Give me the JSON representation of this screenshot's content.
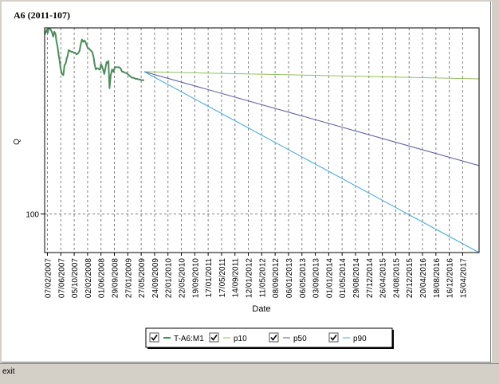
{
  "status_bar": {
    "text": "exit"
  },
  "colors": {
    "panel_bg": "#ffffff",
    "plot_border": "#000000",
    "grid": "#808080",
    "title": "#00008b",
    "history": "#4e8a5c",
    "p10": "#8fbf5f",
    "p50": "#5a5a9c",
    "p90": "#48a8d0"
  },
  "chart_data": {
    "type": "line",
    "title": "A6 (2011-107)",
    "xlabel": "Date",
    "ylabel": "Q",
    "y_scale": "log",
    "ylim": [
      60,
      1180
    ],
    "y_ticks": [
      100
    ],
    "grid": "dashed vertical at each x tick, dashed horizontal at y tick",
    "legend_position": "bottom-center",
    "x_ticks": [
      "07/02/2007",
      "07/06/2007",
      "05/10/2007",
      "02/02/2008",
      "01/06/2008",
      "29/09/2008",
      "27/01/2009",
      "27/05/2009",
      "24/09/2009",
      "22/01/2010",
      "22/05/2010",
      "19/09/2010",
      "17/01/2011",
      "17/05/2011",
      "14/09/2011",
      "12/01/2012",
      "11/05/2012",
      "08/09/2012",
      "06/01/2013",
      "06/05/2013",
      "03/09/2013",
      "01/01/2014",
      "01/05/2014",
      "29/08/2014",
      "27/12/2014",
      "26/04/2015",
      "24/08/2015",
      "22/12/2015",
      "20/04/2016",
      "18/08/2016",
      "16/12/2016",
      "15/04/2017"
    ],
    "x_tick_offsets": [
      12,
      8,
      4,
      0,
      -4,
      -8,
      -12,
      -16,
      -20,
      -24,
      -28,
      -32,
      -36,
      -40,
      -44,
      -48,
      -52,
      -56,
      -60,
      -64,
      -68,
      -72,
      -76,
      -80,
      -84,
      -88,
      -92,
      -96,
      -100,
      -104,
      -108,
      -112
    ],
    "x_domain_days": [
      -12,
      3750
    ],
    "series": [
      {
        "name": "T-A6:M1",
        "checked": true,
        "color_key": "history",
        "x": [
          -12,
          5,
          15,
          22,
          30,
          38,
          50,
          62,
          72,
          82,
          90,
          100,
          110,
          118,
          126,
          138,
          150,
          160,
          170,
          180,
          188,
          196,
          206,
          218,
          228,
          240,
          252,
          264,
          276,
          290,
          302,
          312,
          322,
          332,
          342,
          352,
          362,
          372,
          382,
          392,
          402,
          412,
          422,
          432,
          440,
          450,
          460,
          468,
          476,
          484,
          494,
          504,
          514,
          524,
          532,
          540,
          550,
          560,
          572,
          584,
          596,
          610,
          622,
          634,
          646,
          658,
          670,
          682,
          694,
          706,
          718,
          730,
          742,
          754,
          766,
          778,
          790,
          802,
          814,
          826,
          838,
          850
        ],
        "y": [
          1080,
          1150,
          1100,
          1170,
          1175,
          1160,
          1120,
          1050,
          1120,
          1090,
          990,
          920,
          820,
          760,
          690,
          640,
          630,
          720,
          735,
          790,
          820,
          880,
          870,
          860,
          860,
          850,
          850,
          830,
          840,
          870,
          960,
          1010,
          980,
          1000,
          980,
          940,
          900,
          900,
          880,
          870,
          850,
          800,
          720,
          680,
          690,
          690,
          680,
          680,
          730,
          710,
          680,
          640,
          690,
          750,
          740,
          760,
          530,
          630,
          680,
          660,
          700,
          700,
          700,
          700,
          690,
          660,
          660,
          650,
          650,
          640,
          630,
          620,
          610,
          610,
          605,
          600,
          600,
          595,
          595,
          590,
          590,
          590
        ]
      },
      {
        "name": "p10",
        "checked": true,
        "color_key": "p10",
        "x": [
          850,
          3750
        ],
        "y": [
          660,
          600
        ]
      },
      {
        "name": "p50",
        "checked": true,
        "color_key": "p50",
        "x": [
          850,
          3750
        ],
        "y": [
          660,
          190
        ]
      },
      {
        "name": "p90",
        "checked": true,
        "color_key": "p90",
        "x": [
          850,
          3750
        ],
        "y": [
          660,
          60
        ]
      }
    ]
  }
}
